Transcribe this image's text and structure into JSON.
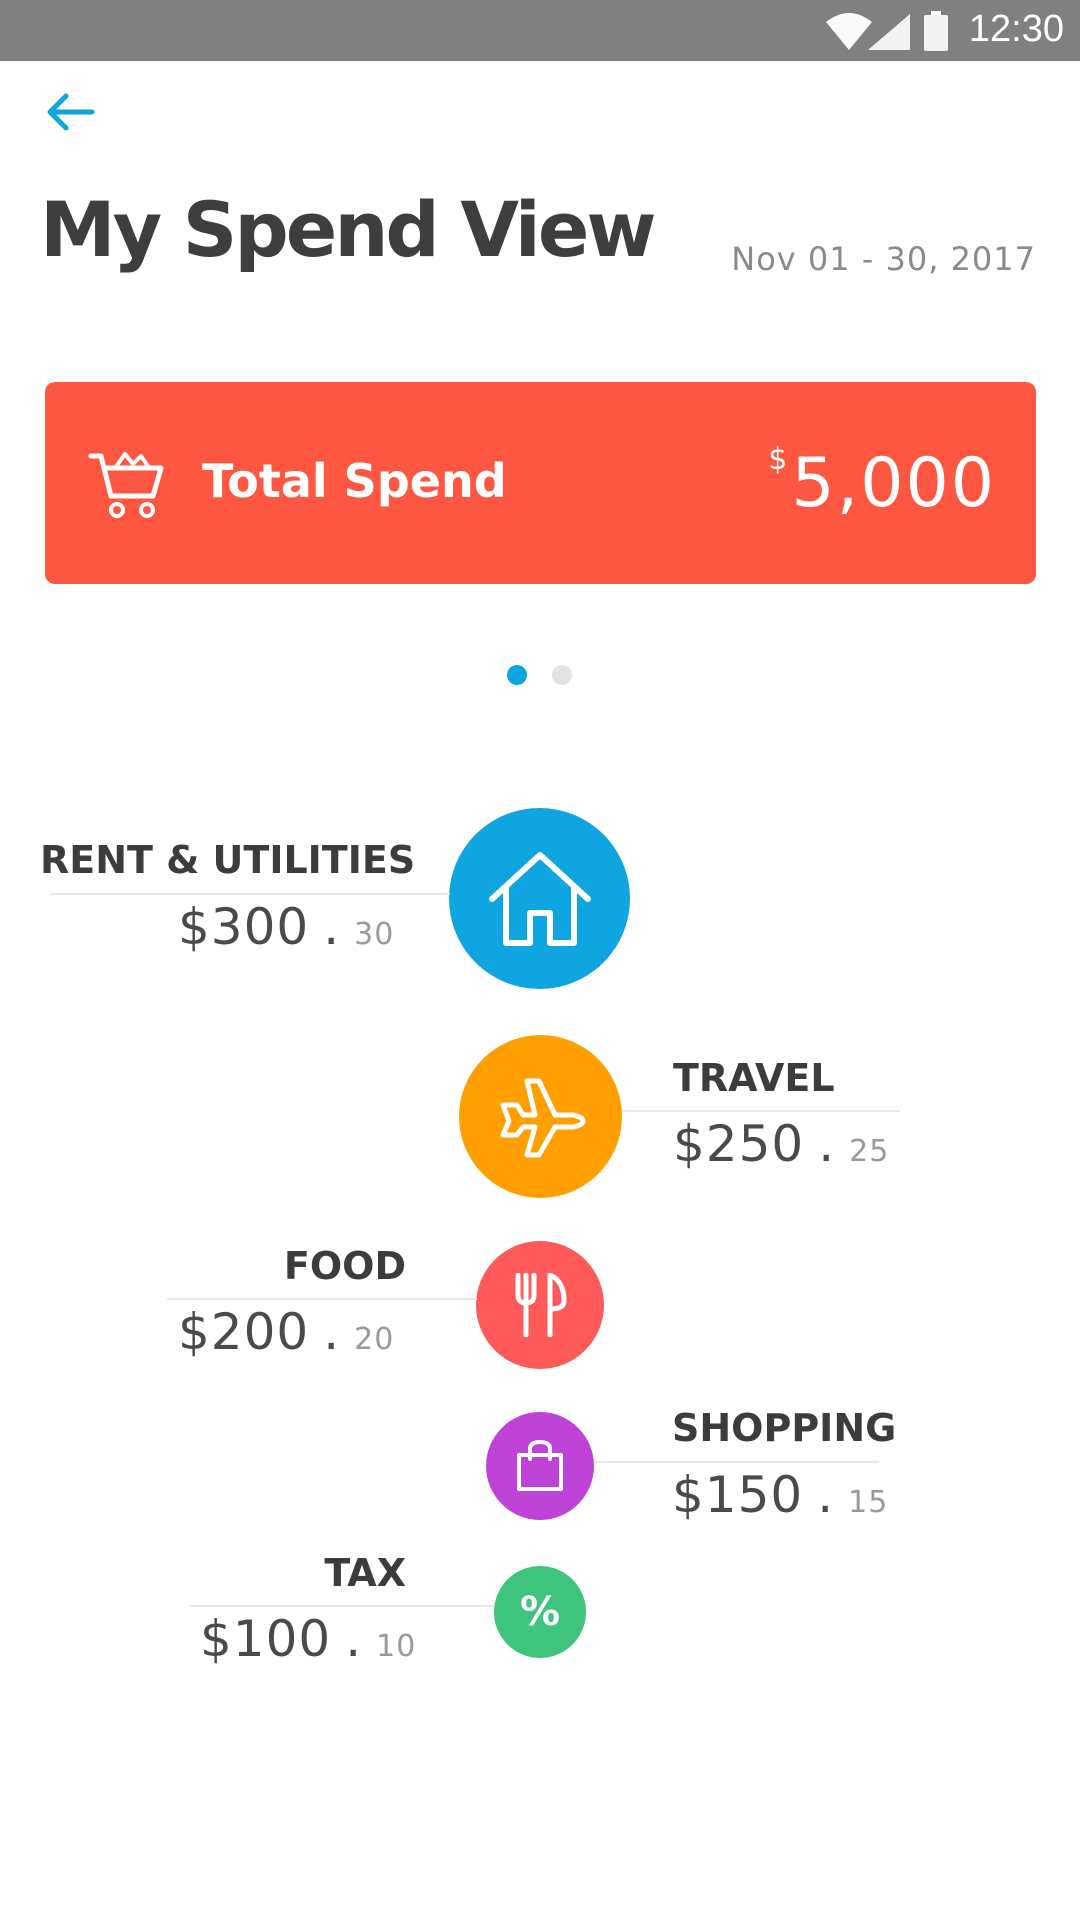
{
  "status_bar": {
    "time": "12:30",
    "icons": [
      "wifi-icon",
      "signal-icon",
      "battery-icon"
    ]
  },
  "header": {
    "back_icon": "arrow-left-icon",
    "title": "My Spend View",
    "date_range": "Nov 01 - 30, 2017"
  },
  "total_card": {
    "icon": "shopping-cart-icon",
    "label": "Total Spend",
    "currency": "$",
    "amount": "5,000",
    "color": "#fe5741"
  },
  "pager": {
    "pages": 2,
    "active_index": 0
  },
  "categories": [
    {
      "name": "RENT & UTILITIES",
      "dollars": "$300",
      "dot": ".",
      "cents": "30",
      "icon": "house-icon",
      "color": "#0ea5e0"
    },
    {
      "name": "TRAVEL",
      "dollars": "$250",
      "dot": ".",
      "cents": "25",
      "icon": "airplane-icon",
      "color": "#ffa000"
    },
    {
      "name": "FOOD",
      "dollars": "$200",
      "dot": ".",
      "cents": "20",
      "icon": "fork-knife-icon",
      "color": "#fe5a5a"
    },
    {
      "name": "SHOPPING",
      "dollars": "$150",
      "dot": ".",
      "cents": "15",
      "icon": "shopping-bag-icon",
      "color": "#c043d8"
    },
    {
      "name": "TAX",
      "dollars": "$100",
      "dot": ".",
      "cents": "10",
      "icon": "percent-icon",
      "icon_text": "%",
      "color": "#3ec47c"
    }
  ]
}
